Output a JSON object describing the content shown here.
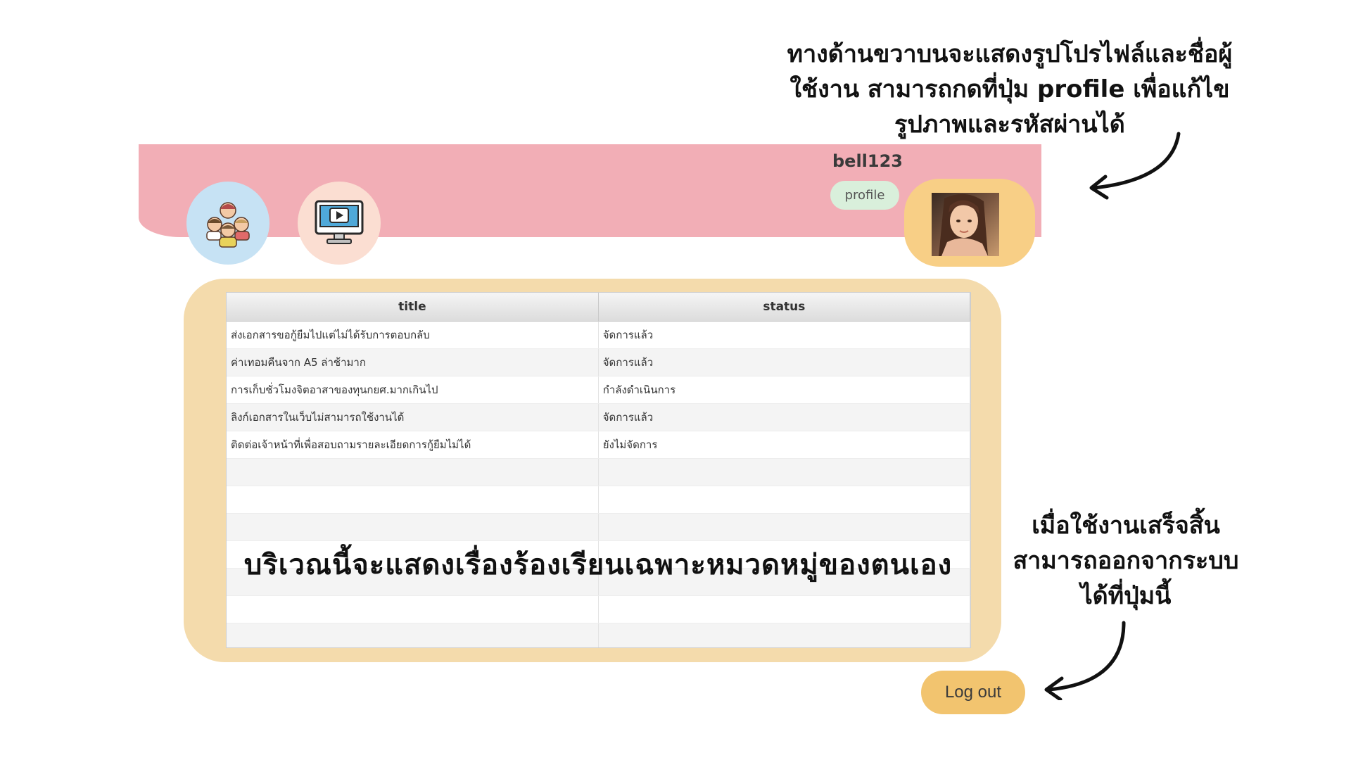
{
  "header": {
    "username": "bell123",
    "profile_label": "profile"
  },
  "nav": {
    "users_icon": "users-group-icon",
    "video_icon": "monitor-video-icon"
  },
  "table": {
    "columns": [
      "title",
      "status"
    ],
    "rows": [
      {
        "title": "ส่งเอกสารขอกู้ยืมไปแต่ไม่ได้รับการตอบกลับ",
        "status": "จัดการแล้ว"
      },
      {
        "title": "ค่าเทอมคืนจาก A5 ล่าช้ามาก",
        "status": "จัดการแล้ว"
      },
      {
        "title": "การเก็บชั่วโมงจิตอาสาของทุนกยศ.มากเกินไป",
        "status": "กำลังดำเนินการ"
      },
      {
        "title": "ลิงก์เอกสารในเว็บไม่สามารถใช้งานได้",
        "status": "จัดการแล้ว"
      },
      {
        "title": "ติดต่อเจ้าหน้าที่เพื่อสอบถามรายละเอียดการกู้ยืมไม่ได้",
        "status": "ยังไม่จัดการ"
      }
    ],
    "empty_rows": 7
  },
  "annotations": {
    "top_right_note": [
      "ทางด้านขวาบนจะแสดงรูปโปรไฟล์และชื่อผู้",
      "ใช้งาน สามารถกดที่ปุ่ม profile เพื่อแก้ไข",
      "รูปภาพและรหัสผ่านได้"
    ],
    "center_note": "บริเวณนี้จะแสดงเรื่องร้องเรียนเฉพาะหมวดหมู่ของตนเอง",
    "bottom_right_note": [
      "เมื่อใช้งานเสร็จสิ้น",
      "สามารถออกจากระบบ",
      "ได้ที่ปุ่มนี้"
    ]
  },
  "logout_label": "Log out",
  "colors": {
    "header_pink": "#f2aeb6",
    "panel_tan": "#f4dbac",
    "avatar_orange": "#f8cf86",
    "logout_gold": "#f2c46f",
    "profile_green": "#d9efdb",
    "users_blue": "#c6e2f4",
    "video_peach": "#fbded2"
  }
}
